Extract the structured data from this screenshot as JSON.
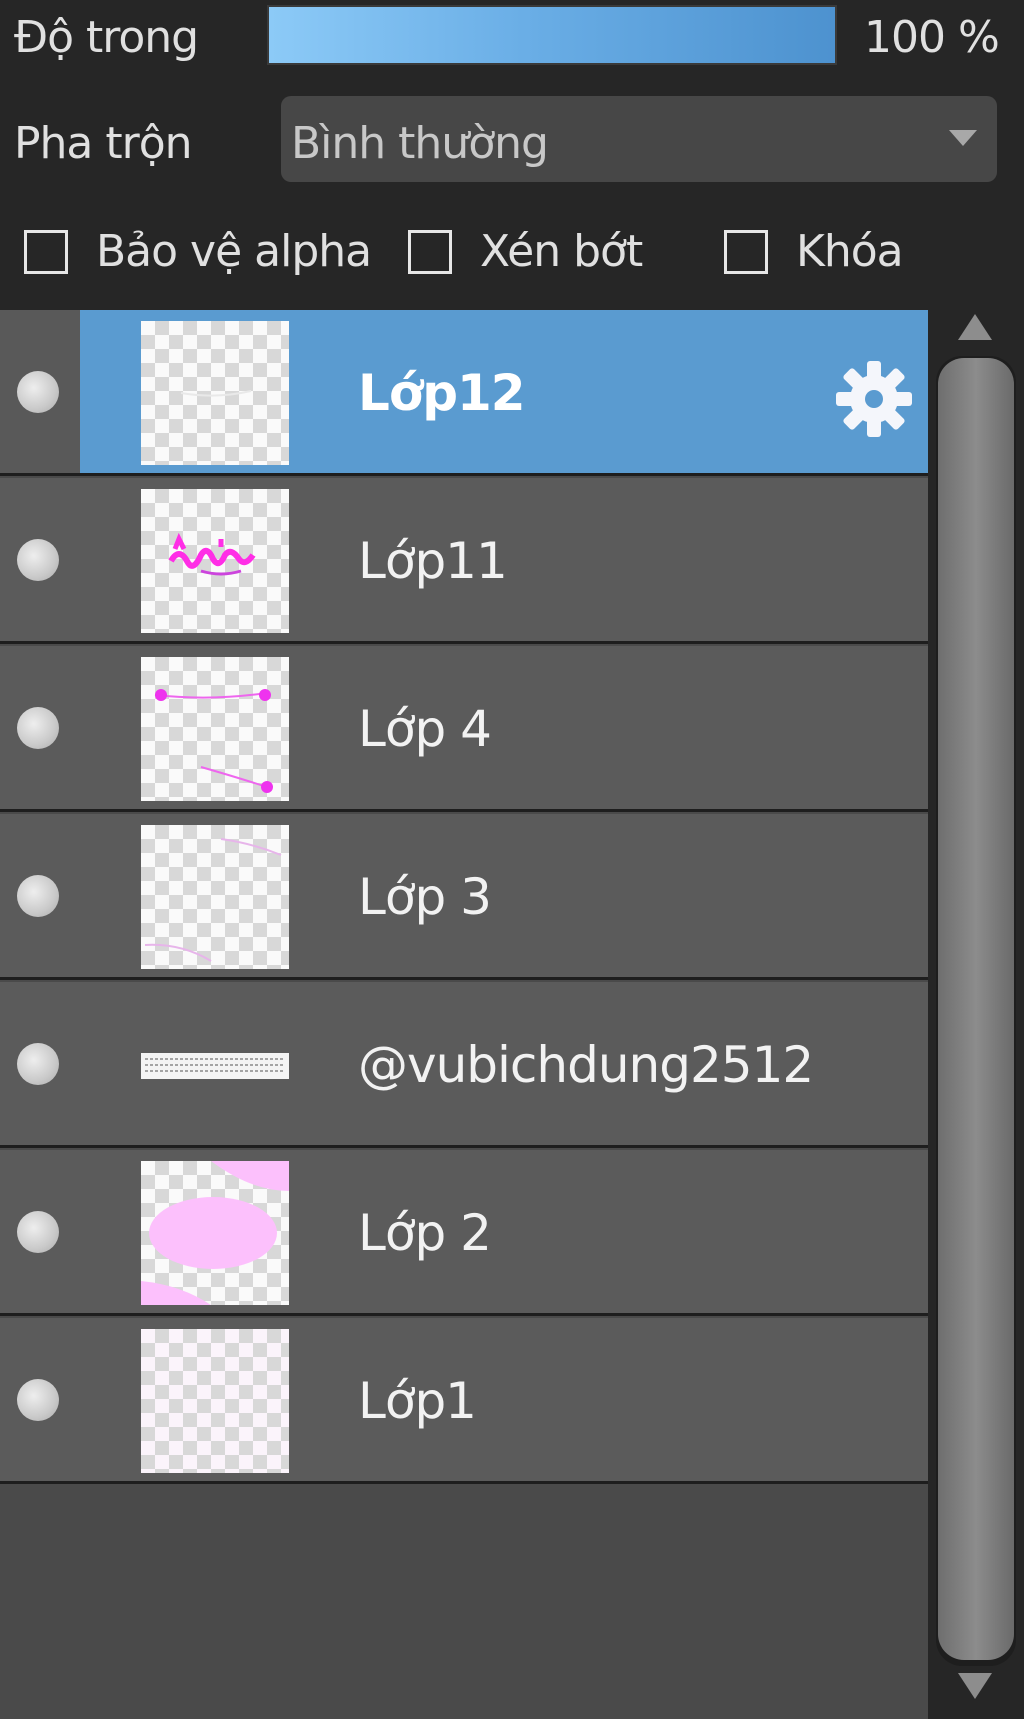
{
  "opacity": {
    "label": "Độ trong",
    "value": 1.0,
    "value_text": "100 %"
  },
  "blend": {
    "label": "Pha trộn",
    "value": "Bình thường"
  },
  "checkboxes": [
    {
      "label": "Bảo vệ alpha",
      "checked": false
    },
    {
      "label": "Xén bớt",
      "checked": false
    },
    {
      "label": "Khóa",
      "checked": false
    }
  ],
  "layers": [
    {
      "name": "Lớp12",
      "selected": true,
      "thumb_icon": "blank-layer-thumbnail"
    },
    {
      "name": "Lớp11",
      "selected": false,
      "thumb_icon": "pink-text-scribble-thumbnail"
    },
    {
      "name": "Lớp 4",
      "selected": false,
      "thumb_icon": "pink-line-dots-thumbnail"
    },
    {
      "name": "Lớp 3",
      "selected": false,
      "thumb_icon": "faint-pink-curves-thumbnail"
    },
    {
      "name": "@vubichdung2512",
      "selected": false,
      "thumb_icon": "white-text-strip-thumbnail"
    },
    {
      "name": "Lớp 2",
      "selected": false,
      "thumb_icon": "pink-blob-thumbnail"
    },
    {
      "name": "Lớp1",
      "selected": false,
      "thumb_icon": "pale-pink-fill-thumbnail"
    }
  ],
  "colors": {
    "selected_row": "#5a9bd0",
    "row": "#5b5b5b",
    "accent_pink": "#ff33ee"
  }
}
